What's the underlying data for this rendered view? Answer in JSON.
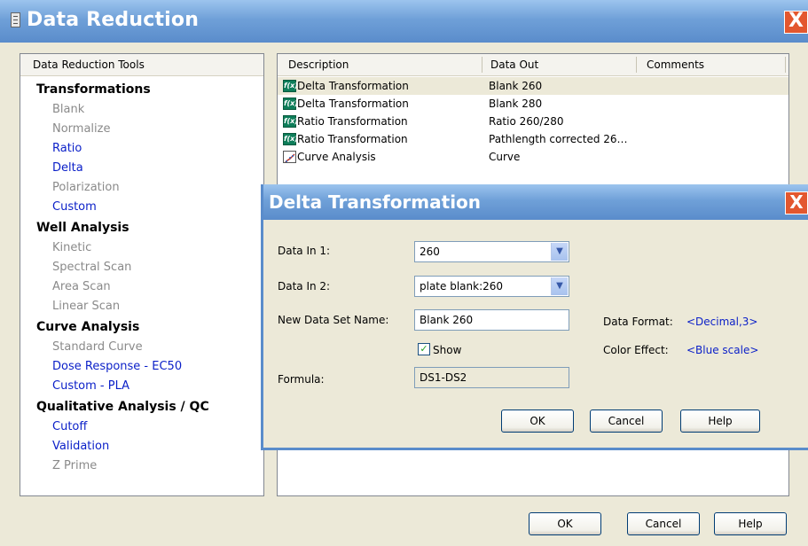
{
  "window": {
    "title": "Data Reduction",
    "close_label": "X"
  },
  "tools": {
    "header": "Data Reduction Tools",
    "groups": [
      {
        "label": "Transformations",
        "items": [
          {
            "label": "Blank",
            "enabled": false
          },
          {
            "label": "Normalize",
            "enabled": false
          },
          {
            "label": "Ratio",
            "enabled": true
          },
          {
            "label": "Delta",
            "enabled": true
          },
          {
            "label": "Polarization",
            "enabled": false
          },
          {
            "label": "Custom",
            "enabled": true
          }
        ]
      },
      {
        "label": "Well Analysis",
        "items": [
          {
            "label": "Kinetic",
            "enabled": false
          },
          {
            "label": "Spectral Scan",
            "enabled": false
          },
          {
            "label": "Area Scan",
            "enabled": false
          },
          {
            "label": "Linear Scan",
            "enabled": false
          }
        ]
      },
      {
        "label": "Curve Analysis",
        "items": [
          {
            "label": "Standard Curve",
            "enabled": false
          },
          {
            "label": "Dose Response - EC50",
            "enabled": true
          },
          {
            "label": "Custom - PLA",
            "enabled": true
          }
        ]
      },
      {
        "label": "Qualitative Analysis / QC",
        "items": [
          {
            "label": "Cutoff",
            "enabled": true
          },
          {
            "label": "Validation",
            "enabled": true
          },
          {
            "label": "Z Prime",
            "enabled": false
          }
        ]
      }
    ]
  },
  "list": {
    "columns": [
      "Description",
      "Data Out",
      "Comments"
    ],
    "rows": [
      {
        "icon": "fx-transformation-icon",
        "description": "Delta Transformation",
        "data_out": "Blank 260",
        "selected": true
      },
      {
        "icon": "fx-transformation-icon",
        "description": "Delta Transformation",
        "data_out": "Blank 280",
        "selected": false
      },
      {
        "icon": "fx-transformation-icon",
        "description": "Ratio Transformation",
        "data_out": "Ratio 260/280",
        "selected": false
      },
      {
        "icon": "fx-transformation-icon",
        "description": "Ratio Transformation",
        "data_out": "Pathlength corrected 26…",
        "selected": false
      },
      {
        "icon": "curve-analysis-icon",
        "description": "Curve Analysis",
        "data_out": "Curve",
        "selected": false
      }
    ],
    "fx_icon_text": "f(x)"
  },
  "main_buttons": {
    "ok": "OK",
    "cancel": "Cancel",
    "help": "Help"
  },
  "dialog": {
    "title": "Delta Transformation",
    "close_label": "X",
    "data_in_1": {
      "label": "Data In 1:",
      "value": "260"
    },
    "data_in_2": {
      "label": "Data In 2:",
      "value": "plate blank:260"
    },
    "new_data_set": {
      "label": "New Data Set Name:",
      "value": "Blank 260"
    },
    "show": {
      "label": "Show",
      "checked": true
    },
    "formula": {
      "label": "Formula:",
      "value": "DS1-DS2"
    },
    "data_format": {
      "label": "Data Format:",
      "value": "<Decimal,3>"
    },
    "color_effect": {
      "label": "Color Effect:",
      "value": "<Blue scale>"
    },
    "buttons": {
      "ok": "OK",
      "cancel": "Cancel",
      "help": "Help"
    }
  },
  "colors": {
    "titlebar": "#6FA0D8",
    "enabled_link": "#0A1FC8",
    "disabled_text": "#8A8A8A",
    "close_button": "#E3572F"
  }
}
